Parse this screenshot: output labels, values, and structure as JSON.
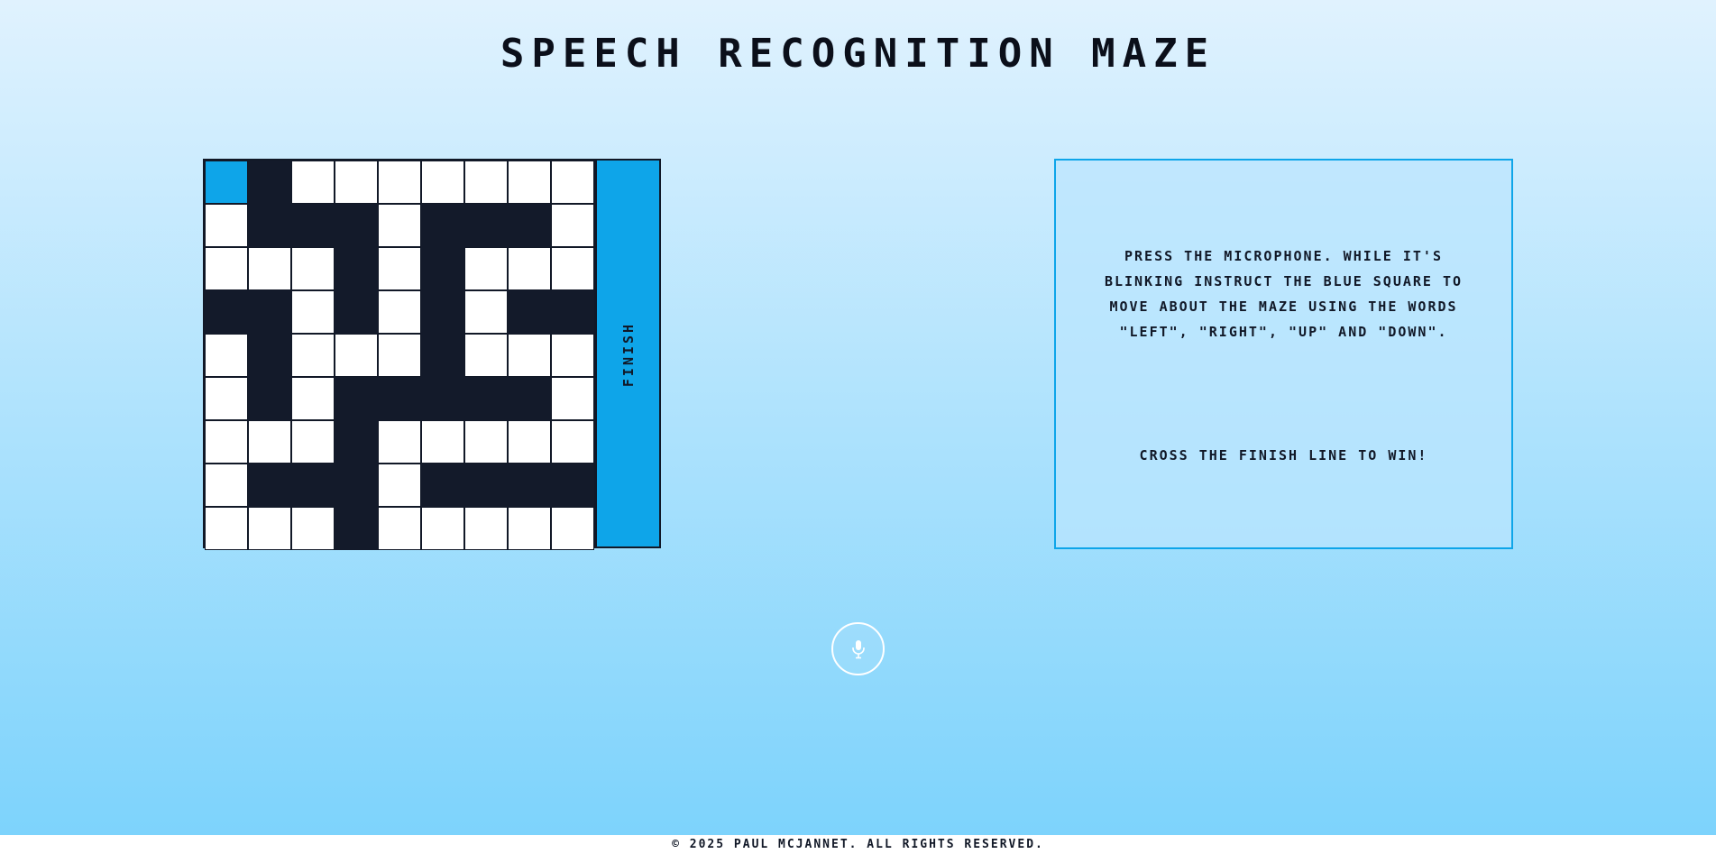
{
  "header": {
    "title": "SPEECH RECOGNITION MAZE"
  },
  "maze": {
    "rows": [
      "PW.......",
      ".WWW.WWW.",
      "...W.W...",
      "WW.W.W.WW",
      ".W...W...",
      ".W.WWWWW.",
      "...W.....",
      ".WWW.WWWW",
      "...W....."
    ],
    "legend": {
      "P": "player",
      "W": "wall",
      ".": "path"
    },
    "finish_label": "FINISH",
    "colors": {
      "player": "#0ea5e9",
      "wall": "#131a2a",
      "path": "#ffffff",
      "finish": "#0ea5e9"
    }
  },
  "info": {
    "instructions": "Press the microphone. While it's blinking instruct the blue square to move about the maze using the words \"left\", \"right\", \"up\" and \"down\".",
    "goal": "Cross the finish line to win!"
  },
  "mic": {
    "icon": "microphone-icon"
  },
  "footer": {
    "copyright": "© 2025 Paul McJannet. All rights reserved."
  }
}
